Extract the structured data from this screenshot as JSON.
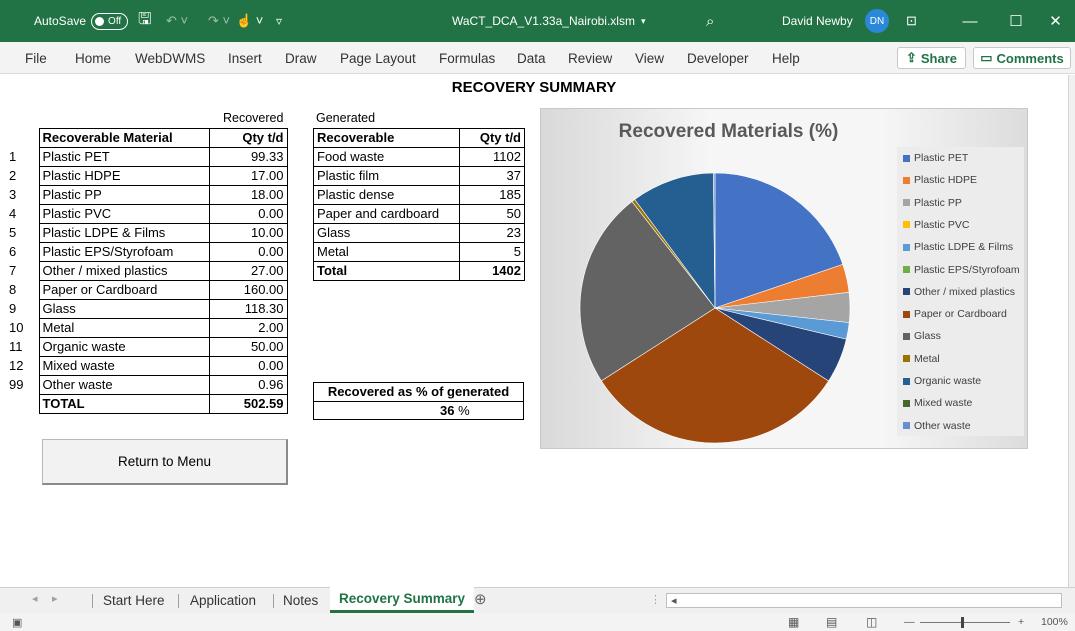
{
  "titlebar": {
    "autosave_label": "AutoSave",
    "autosave_state": "Off",
    "file_name": "WaCT_DCA_V1.33a_Nairobi.xlsm",
    "user_name": "David Newby",
    "user_initials": "DN",
    "accent_color": "#217346"
  },
  "ribbon": {
    "tabs": [
      "File",
      "Home",
      "WebDWMS",
      "Insert",
      "Draw",
      "Page Layout",
      "Formulas",
      "Data",
      "Review",
      "View",
      "Developer",
      "Help"
    ],
    "share_label": "Share",
    "comments_label": "Comments"
  },
  "sheet": {
    "title": "RECOVERY SUMMARY",
    "recovered_caption": "Recovered",
    "generated_caption": "Generated",
    "recovered_table": {
      "headers": [
        "Recoverable Material",
        "Qty t/d"
      ],
      "rows": [
        {
          "idx": "1",
          "name": "Plastic PET",
          "qty": "99.33"
        },
        {
          "idx": "2",
          "name": "Plastic HDPE",
          "qty": "17.00"
        },
        {
          "idx": "3",
          "name": "Plastic PP",
          "qty": "18.00"
        },
        {
          "idx": "4",
          "name": "Plastic PVC",
          "qty": "0.00"
        },
        {
          "idx": "5",
          "name": "Plastic LDPE & Films",
          "qty": "10.00"
        },
        {
          "idx": "6",
          "name": "Plastic EPS/Styrofoam",
          "qty": "0.00"
        },
        {
          "idx": "7",
          "name": "Other / mixed plastics",
          "qty": "27.00"
        },
        {
          "idx": "8",
          "name": "Paper or Cardboard",
          "qty": "160.00"
        },
        {
          "idx": "9",
          "name": "Glass",
          "qty": "118.30"
        },
        {
          "idx": "10",
          "name": "Metal",
          "qty": "2.00"
        },
        {
          "idx": "11",
          "name": "Organic waste",
          "qty": "50.00"
        },
        {
          "idx": "12",
          "name": "Mixed waste",
          "qty": "0.00"
        },
        {
          "idx": "99",
          "name": "Other waste",
          "qty": "0.96"
        }
      ],
      "total_label": "TOTAL",
      "total_value": "502.59"
    },
    "generated_table": {
      "headers": [
        "Recoverable",
        "Qty t/d"
      ],
      "rows": [
        {
          "name": "Food waste",
          "qty": "1102"
        },
        {
          "name": "Plastic film",
          "qty": "37"
        },
        {
          "name": "Plastic dense",
          "qty": "185"
        },
        {
          "name": "Paper and cardboard",
          "qty": "50"
        },
        {
          "name": "Glass",
          "qty": "23"
        },
        {
          "name": "Metal",
          "qty": "5"
        }
      ],
      "total_label": "Total",
      "total_value": "1402"
    },
    "percent_box": {
      "title": "Recovered as % of generated",
      "value": "36",
      "unit": "%"
    },
    "return_button": "Return to Menu"
  },
  "chart_data": {
    "type": "pie",
    "title": "Recovered Materials (%)",
    "categories": [
      "Plastic PET",
      "Plastic HDPE",
      "Plastic PP",
      "Plastic PVC",
      "Plastic LDPE & Films",
      "Plastic EPS/Styrofoam",
      "Other / mixed plastics",
      "Paper or Cardboard",
      "Glass",
      "Metal",
      "Organic waste",
      "Mixed waste",
      "Other waste"
    ],
    "values": [
      99.33,
      17.0,
      18.0,
      0.0,
      10.0,
      0.0,
      27.0,
      160.0,
      118.3,
      2.0,
      50.0,
      0.0,
      0.96
    ],
    "colors": [
      "#4472c4",
      "#ed7d31",
      "#a5a5a5",
      "#ffc000",
      "#5b9bd5",
      "#70ad47",
      "#264478",
      "#9e480e",
      "#636363",
      "#997300",
      "#255e91",
      "#43682b",
      "#698ed0"
    ],
    "legend": "right"
  },
  "sheet_tabs": {
    "tabs": [
      "Start Here",
      "Application",
      "Notes",
      "Recovery Summary"
    ],
    "active": "Recovery Summary"
  },
  "statusbar": {
    "zoom": "100%"
  }
}
